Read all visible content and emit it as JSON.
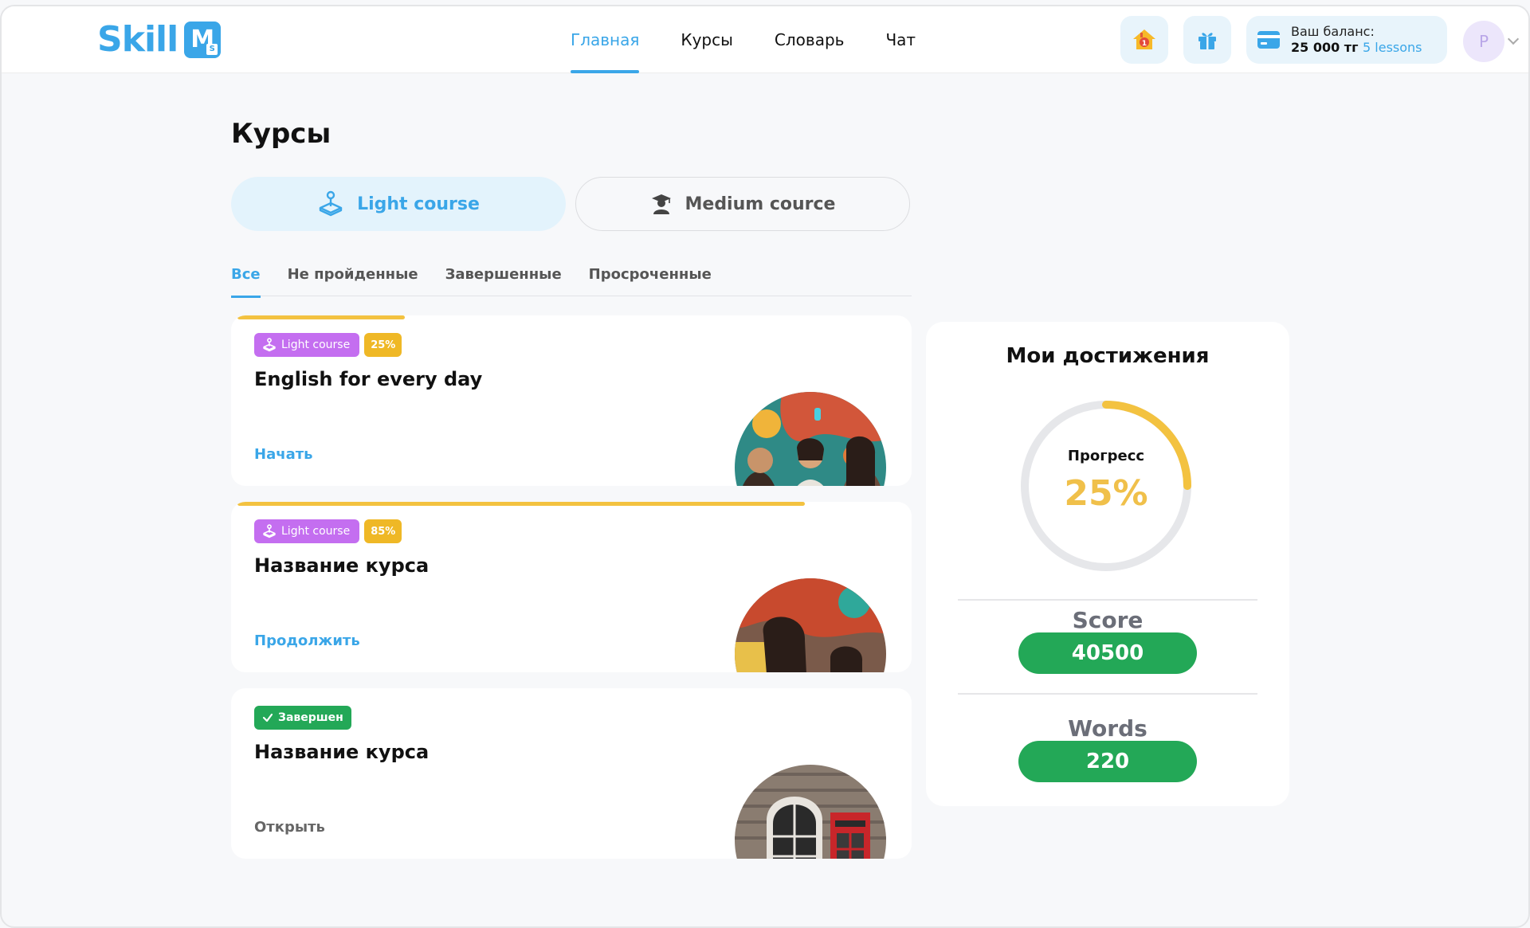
{
  "header": {
    "logo_text": "Skill",
    "logo_mark": "M",
    "logo_mark_small": "S",
    "nav": [
      {
        "label": "Главная",
        "active": true
      },
      {
        "label": "Курсы",
        "active": false
      },
      {
        "label": "Словарь",
        "active": false
      },
      {
        "label": "Чат",
        "active": false
      }
    ],
    "home_icon": "home-notification-icon",
    "home_badge_count": "1",
    "gift_icon": "gift-icon",
    "balance_label": "Ваш баланс:",
    "balance_amount": "25 000 тг",
    "balance_lessons": "5 lessons",
    "avatar_initial": "P"
  },
  "page": {
    "title": "Курсы",
    "course_switch": [
      {
        "label": "Light course",
        "icon": "joystick-icon",
        "active": true
      },
      {
        "label": "Medium cource",
        "icon": "graduate-icon",
        "active": false
      }
    ],
    "tabs": [
      {
        "label": "Все",
        "active": true
      },
      {
        "label": "Не пройденные",
        "active": false
      },
      {
        "label": "Завершенные",
        "active": false
      },
      {
        "label": "Просроченные",
        "active": false
      }
    ]
  },
  "courses": [
    {
      "type_badge": "Light course",
      "progress_badge": "25%",
      "progress": 0.25,
      "title": "English for every day",
      "action": "Начать",
      "image": "friends-laughing-photo"
    },
    {
      "type_badge": "Light course",
      "progress_badge": "85%",
      "progress": 0.85,
      "title": "Название курса",
      "action": "Продолжить",
      "image": "friends-street-photo"
    },
    {
      "status_badge": "Завершен",
      "title": "Название курса",
      "action": "Открыть",
      "image": "london-phone-booth-photo"
    }
  ],
  "achievements": {
    "title": "Мои достижения",
    "progress_label": "Прогресс",
    "progress_value": "25%",
    "progress_fraction": 0.25,
    "score_label": "Score",
    "score_value": "40500",
    "words_label": "Words",
    "words_value": "220"
  },
  "colors": {
    "accent": "#3aa6e8",
    "progress_yellow": "#f3c240",
    "badge_purple": "#c46ef0",
    "success_green": "#23a857"
  }
}
